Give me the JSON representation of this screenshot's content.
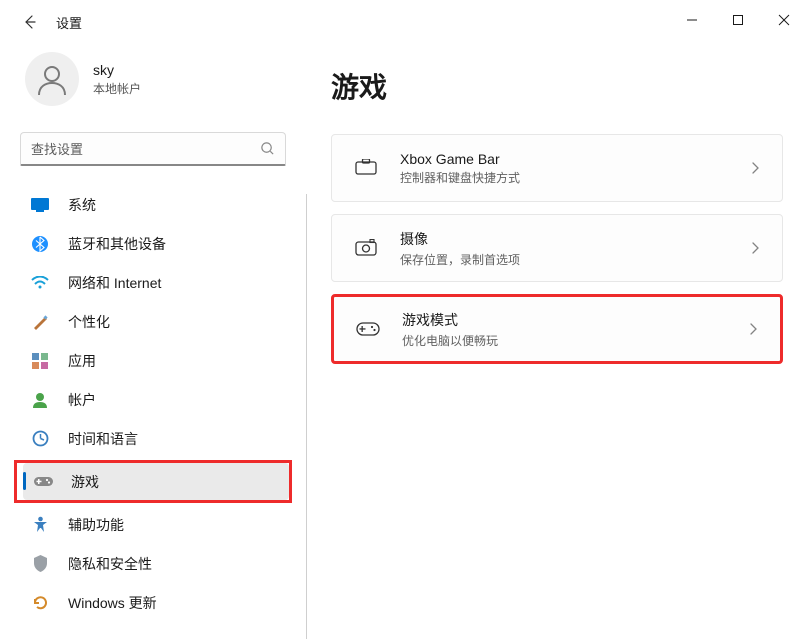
{
  "window": {
    "title": "设置"
  },
  "user": {
    "name": "sky",
    "type": "本地帐户"
  },
  "search": {
    "placeholder": "查找设置"
  },
  "nav": {
    "system": "系统",
    "bluetooth": "蓝牙和其他设备",
    "network": "网络和 Internet",
    "personalization": "个性化",
    "apps": "应用",
    "accounts": "帐户",
    "time": "时间和语言",
    "gaming": "游戏",
    "accessibility": "辅助功能",
    "privacy": "隐私和安全性",
    "update": "Windows 更新"
  },
  "page": {
    "title": "游戏"
  },
  "cards": {
    "xbox": {
      "title": "Xbox Game Bar",
      "sub": "控制器和键盘快捷方式"
    },
    "capture": {
      "title": "摄像",
      "sub": "保存位置，录制首选项"
    },
    "mode": {
      "title": "游戏模式",
      "sub": "优化电脑以便畅玩"
    }
  }
}
